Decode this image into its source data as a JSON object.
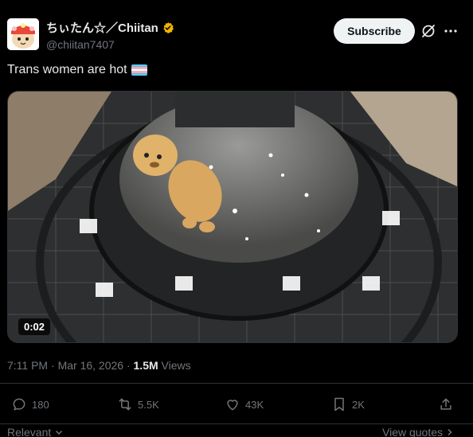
{
  "author": {
    "display_name": "ちぃたん☆／Chiitan",
    "handle": "@chiitan7407",
    "verified_color": "#F4B400"
  },
  "header": {
    "subscribe_label": "Subscribe",
    "grok_icon": "grok-icon",
    "more_icon": "more-horizontal-icon"
  },
  "tweet": {
    "text": "Trans women are hot",
    "flag": "transgender-flag"
  },
  "media": {
    "duration": "0:02"
  },
  "meta": {
    "time": "7:11 PM",
    "sep": " · ",
    "date": "Mar 16, 2026",
    "sep2": " · ",
    "views_count": "1.5M",
    "views_label": " Views"
  },
  "actions": {
    "replies": "180",
    "reposts": "5.5K",
    "likes": "43K",
    "bookmarks": "2K"
  },
  "footer": {
    "relevant_label": "Relevant",
    "view_quotes_label": "View quotes"
  },
  "colors": {
    "background": "#000000",
    "text_primary": "#e7e9ea",
    "text_secondary": "#71767b",
    "divider": "#2f3336"
  }
}
